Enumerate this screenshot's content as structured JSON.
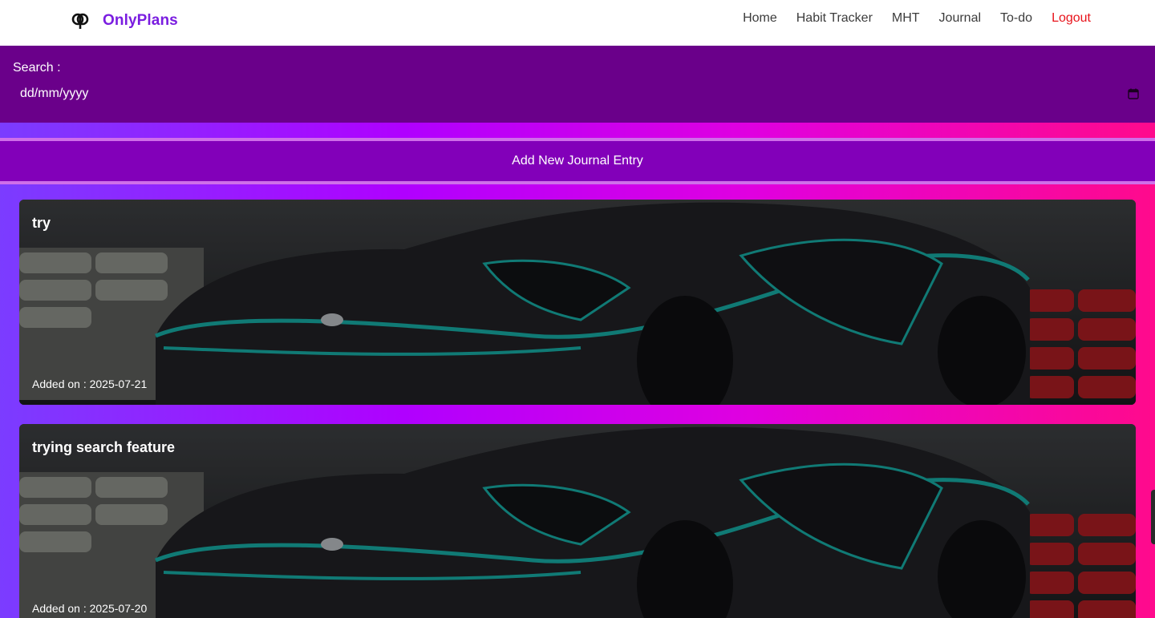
{
  "nav": {
    "brand": "OnlyPlans",
    "links": [
      {
        "label": "Home"
      },
      {
        "label": "Habit Tracker"
      },
      {
        "label": "MHT"
      },
      {
        "label": "Journal"
      },
      {
        "label": "To-do"
      },
      {
        "label": "Logout"
      }
    ]
  },
  "search": {
    "label": "Search :",
    "placeholder": "dd/mm/yyyy"
  },
  "add_entry": {
    "label": "Add New Journal Entry"
  },
  "entries": [
    {
      "title": "try",
      "date_text": "Added on : 2025-07-21"
    },
    {
      "title": "trying search feature",
      "date_text": "Added on : 2025-07-20"
    }
  ],
  "colors": {
    "brand": "#7a1de0",
    "logout": "#e8131b",
    "search_bg": "#6a008a",
    "add_entry_bg": "#8200b9"
  }
}
